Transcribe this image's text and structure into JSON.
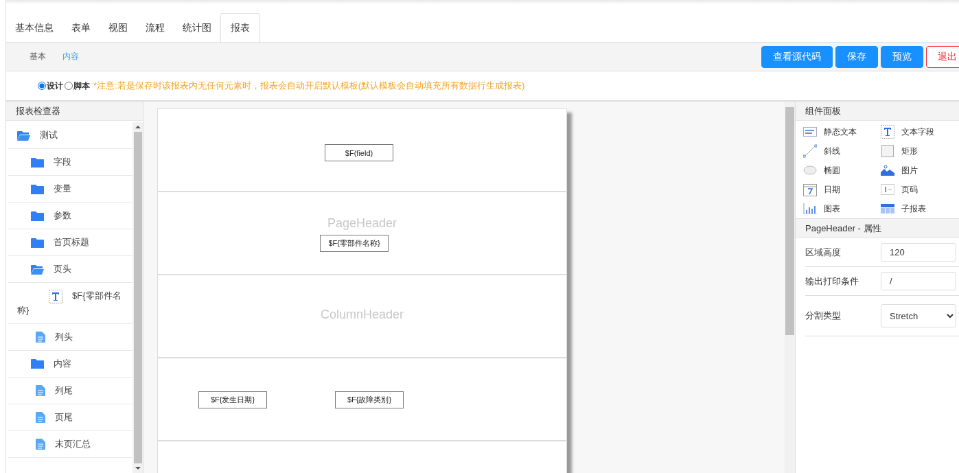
{
  "tabs": [
    {
      "label": "基本信息",
      "selected": false
    },
    {
      "label": "表单",
      "selected": false
    },
    {
      "label": "视图",
      "selected": false
    },
    {
      "label": "流程",
      "selected": false
    },
    {
      "label": "统计图",
      "selected": false
    },
    {
      "label": "报表",
      "selected": true
    }
  ],
  "subtabs": [
    {
      "label": "基本",
      "selected": false
    },
    {
      "label": "内容",
      "selected": true
    }
  ],
  "buttons": [
    {
      "label": "查看源代码",
      "kind": "primary"
    },
    {
      "label": "保存",
      "kind": "primary"
    },
    {
      "label": "预览",
      "kind": "primary"
    },
    {
      "label": "退出",
      "kind": "danger"
    }
  ],
  "mode": {
    "options": [
      {
        "label": "设计",
        "selected": true
      },
      {
        "label": "脚本",
        "selected": false
      }
    ],
    "notice": "*注意:若是保存时该报表内无任何元素时，报表会自动开启默认模板(默认模板会自动填充所有数据行生成报表)"
  },
  "inspector": {
    "title": "报表检查器",
    "items": [
      {
        "label": "测试",
        "kind": "folder",
        "expanded": true,
        "children": [
          {
            "label": "字段",
            "kind": "folder",
            "expanded": false
          },
          {
            "label": "变量",
            "kind": "folder",
            "expanded": false
          },
          {
            "label": "参数",
            "kind": "folder",
            "expanded": false
          },
          {
            "label": "首页标题",
            "kind": "folder",
            "expanded": false
          },
          {
            "label": "页头",
            "kind": "folder",
            "expanded": true,
            "children": [
              {
                "label": "$F{零部件名称}",
                "kind": "text-field"
              }
            ]
          },
          {
            "label": "列头",
            "kind": "file"
          },
          {
            "label": "内容",
            "kind": "folder",
            "expanded": false
          },
          {
            "label": "列尾",
            "kind": "file"
          },
          {
            "label": "页尾",
            "kind": "file"
          },
          {
            "label": "末页汇总",
            "kind": "file"
          }
        ]
      }
    ]
  },
  "canvas": {
    "bands": [
      {
        "fields": [
          "$F(field)"
        ]
      },
      {
        "label": "PageHeader",
        "fields": [
          "$F{零部件名称}"
        ]
      },
      {
        "label": "ColumnHeader"
      },
      {
        "fields": [
          "$F{发生日期}",
          "$F{故障类别}"
        ]
      }
    ]
  },
  "palette": {
    "title": "组件面板",
    "items": [
      {
        "label": "静态文本",
        "kind": "static-text"
      },
      {
        "label": "文本字段",
        "kind": "text-field"
      },
      {
        "label": "斜线",
        "kind": "line"
      },
      {
        "label": "矩形",
        "kind": "rectangle"
      },
      {
        "label": "椭圆",
        "kind": "ellipse"
      },
      {
        "label": "图片",
        "kind": "image"
      },
      {
        "label": "日期",
        "kind": "date"
      },
      {
        "label": "页码",
        "kind": "page-number"
      },
      {
        "label": "图表",
        "kind": "chart"
      },
      {
        "label": "子报表",
        "kind": "subreport"
      }
    ]
  },
  "properties": {
    "title": "PageHeader - 属性",
    "rows": [
      {
        "label": "区域高度",
        "kind": "input",
        "value": "120"
      },
      {
        "label": "输出打印条件",
        "kind": "input",
        "value": "/"
      },
      {
        "label": "分割类型",
        "kind": "select",
        "value": "Stretch"
      }
    ]
  }
}
